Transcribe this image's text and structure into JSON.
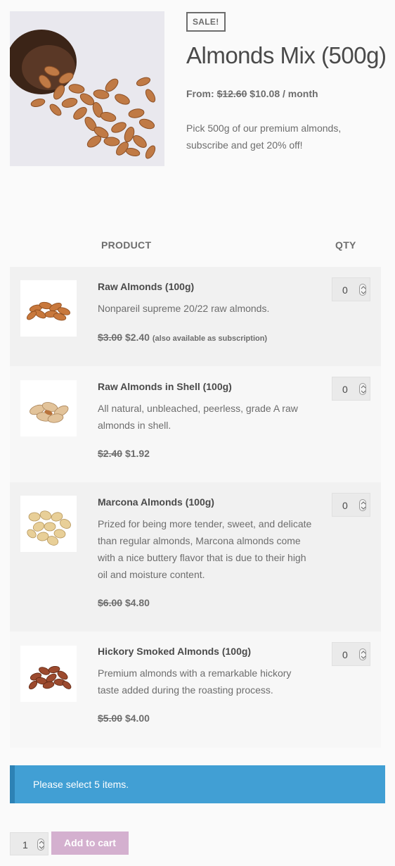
{
  "product": {
    "badge": "SALE!",
    "title": "Almonds Mix (500g)",
    "price": {
      "prefix": "From:",
      "original": "$12.60",
      "sale": "$10.08",
      "period": "/ month"
    },
    "short_description": "Pick 500g of our premium almonds, subscribe and get 20% off!",
    "image_icon": "almonds-bowl-image"
  },
  "table": {
    "headers": {
      "product": "PRODUCT",
      "qty": "QTY"
    },
    "items": [
      {
        "title": "Raw Almonds (100g)",
        "description": "Nonpareil supreme 20/22 raw almonds.",
        "original_price": "$3.00",
        "sale_price": "$2.40",
        "note": "(also available as subscription)",
        "qty": "0"
      },
      {
        "title": "Raw Almonds in Shell (100g)",
        "description": "All natural, unbleached, peerless, grade A raw almonds in shell.",
        "original_price": "$2.40",
        "sale_price": "$1.92",
        "note": "",
        "qty": "0"
      },
      {
        "title": "Marcona Almonds (100g)",
        "description": "Prized for being more tender, sweet, and delicate than regular almonds, Marcona almonds come with a nice buttery flavor that is due to their high oil and moisture content.",
        "original_price": "$6.00",
        "sale_price": "$4.80",
        "note": "",
        "qty": "0"
      },
      {
        "title": "Hickory Smoked Almonds (100g)",
        "description": "Premium almonds with a remarkable hickory taste added during the roasting process.",
        "original_price": "$5.00",
        "sale_price": "$4.00",
        "note": "",
        "qty": "0"
      }
    ]
  },
  "notice": {
    "text": "Please select 5 items.",
    "color": "#419fd4"
  },
  "cart": {
    "qty": "1",
    "button_label": "Add to cart",
    "button_color": "#d4b0cf"
  }
}
